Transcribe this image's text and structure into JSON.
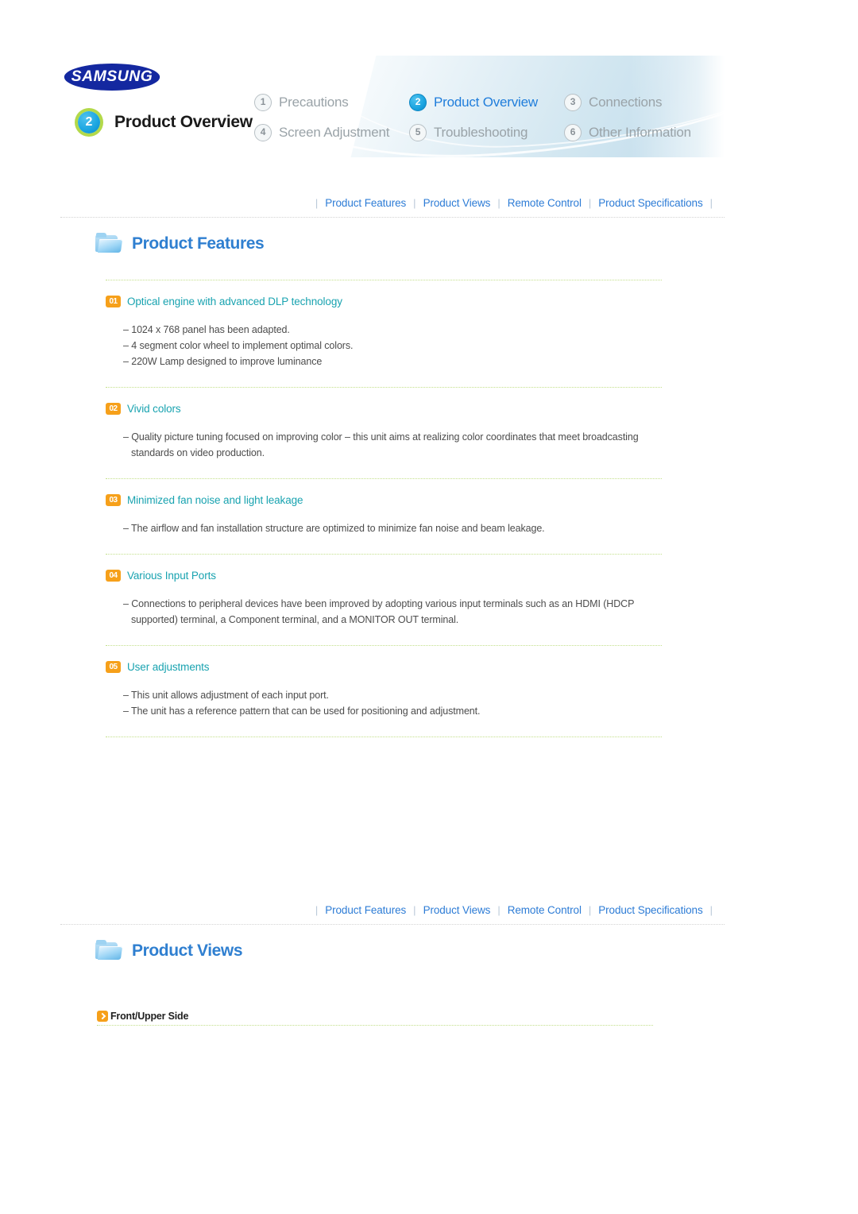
{
  "header": {
    "logo_text": "SAMSUNG",
    "current_chapter_number": "2",
    "current_chapter_label": "Product Overview",
    "chapters": [
      {
        "number": "1",
        "label": "Precautions",
        "active": false
      },
      {
        "number": "2",
        "label": "Product Overview",
        "active": true
      },
      {
        "number": "3",
        "label": "Connections",
        "active": false
      },
      {
        "number": "4",
        "label": "Screen Adjustment",
        "active": false
      },
      {
        "number": "5",
        "label": "Troubleshooting",
        "active": false
      },
      {
        "number": "6",
        "label": "Other Information",
        "active": false
      }
    ]
  },
  "subnav": {
    "items": [
      "Product Features",
      "Product Views",
      "Remote Control",
      "Product Specifications"
    ],
    "separator": "|"
  },
  "sections": {
    "product_features": {
      "title": "Product Features",
      "icon": "folder-icon"
    },
    "product_views": {
      "title": "Product Views",
      "icon": "folder-icon",
      "subblock_label": "Front/Upper Side"
    }
  },
  "features": [
    {
      "number": "01",
      "title": "Optical engine with advanced DLP technology",
      "lines": [
        "– 1024 x 768 panel has been adapted.",
        "– 4 segment color wheel to implement optimal colors.",
        "– 220W Lamp designed to improve luminance"
      ]
    },
    {
      "number": "02",
      "title": "Vivid colors",
      "lines": [
        "– Quality picture tuning focused on improving color – this unit aims at realizing color coordinates that meet broadcasting standards on video production."
      ]
    },
    {
      "number": "03",
      "title": "Minimized fan noise and light leakage",
      "lines": [
        "– The airflow and fan installation structure are optimized to minimize fan noise and beam leakage."
      ]
    },
    {
      "number": "04",
      "title": "Various Input Ports",
      "lines": [
        "– Connections to peripheral devices have been improved by adopting various input terminals such as an HDMI (HDCP supported) terminal, a Component terminal, and a MONITOR OUT terminal."
      ]
    },
    {
      "number": "05",
      "title": "User adjustments",
      "lines": [
        "– This unit allows adjustment of each input port.",
        "– The unit has a reference pattern that can be used for positioning and adjustment."
      ]
    }
  ],
  "colors": {
    "accent_blue": "#2f7fd0",
    "link_blue": "#2d7cd6",
    "feature_teal": "#19a3b0",
    "badge_orange": "#f6a01a",
    "samsung_blue": "#1428a0",
    "divider_green": "#c3e08a"
  }
}
